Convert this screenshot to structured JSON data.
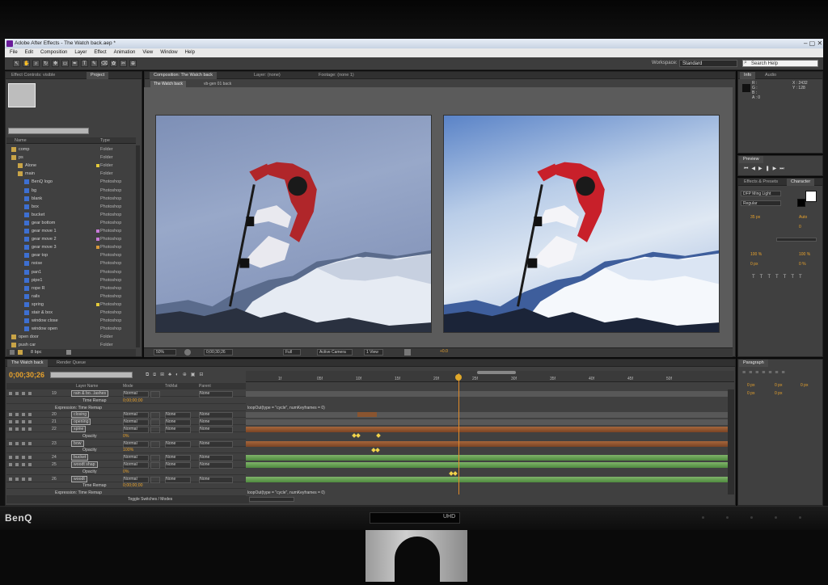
{
  "monitor": {
    "brand": "BenQ",
    "badge": "UHD"
  },
  "window": {
    "title": "Adobe After Effects - The Watch back.aep *"
  },
  "menu": [
    "File",
    "Edit",
    "Composition",
    "Layer",
    "Effect",
    "Animation",
    "View",
    "Window",
    "Help"
  ],
  "toolbar": {
    "workspace_label": "Workspace:",
    "workspace_value": "Standard",
    "search_placeholder": "Search Help"
  },
  "left_panel": {
    "tabs": [
      "Effect Controls: visible",
      "Project"
    ],
    "header": {
      "name": "Name",
      "type": "Type"
    },
    "items": [
      {
        "name": "comp",
        "type": "Folder",
        "kind": "folder",
        "indent": 0,
        "swatch": ""
      },
      {
        "name": "ps",
        "type": "Folder",
        "kind": "folder",
        "indent": 0,
        "swatch": ""
      },
      {
        "name": "Alone",
        "type": "Folder",
        "kind": "folder",
        "indent": 1,
        "swatch": "#e3c93a"
      },
      {
        "name": "main",
        "type": "Folder",
        "kind": "folder",
        "indent": 1,
        "swatch": ""
      },
      {
        "name": "BenQ logo",
        "type": "Photoshop",
        "kind": "file",
        "indent": 2,
        "swatch": ""
      },
      {
        "name": "bg",
        "type": "Photoshop",
        "kind": "file",
        "indent": 2,
        "swatch": ""
      },
      {
        "name": "blank",
        "type": "Photoshop",
        "kind": "file",
        "indent": 2,
        "swatch": ""
      },
      {
        "name": "box",
        "type": "Photoshop",
        "kind": "file",
        "indent": 2,
        "swatch": ""
      },
      {
        "name": "bucket",
        "type": "Photoshop",
        "kind": "file",
        "indent": 2,
        "swatch": ""
      },
      {
        "name": "gear bottom",
        "type": "Photoshop",
        "kind": "file",
        "indent": 2,
        "swatch": ""
      },
      {
        "name": "gear move 1",
        "type": "Photoshop",
        "kind": "file",
        "indent": 2,
        "swatch": "#c77ad8"
      },
      {
        "name": "gear move 2",
        "type": "Photoshop",
        "kind": "file",
        "indent": 2,
        "swatch": "#c77ad8"
      },
      {
        "name": "gear move 3",
        "type": "Photoshop",
        "kind": "file",
        "indent": 2,
        "swatch": "#d89a3a"
      },
      {
        "name": "gear top",
        "type": "Photoshop",
        "kind": "file",
        "indent": 2,
        "swatch": ""
      },
      {
        "name": "noise",
        "type": "Photoshop",
        "kind": "file",
        "indent": 2,
        "swatch": ""
      },
      {
        "name": "pan1",
        "type": "Photoshop",
        "kind": "file",
        "indent": 2,
        "swatch": ""
      },
      {
        "name": "pipe1",
        "type": "Photoshop",
        "kind": "file",
        "indent": 2,
        "swatch": ""
      },
      {
        "name": "rope R",
        "type": "Photoshop",
        "kind": "file",
        "indent": 2,
        "swatch": ""
      },
      {
        "name": "rails",
        "type": "Photoshop",
        "kind": "file",
        "indent": 2,
        "swatch": ""
      },
      {
        "name": "spring",
        "type": "Photoshop",
        "kind": "file",
        "indent": 2,
        "swatch": "#e3c93a"
      },
      {
        "name": "stair & box",
        "type": "Photoshop",
        "kind": "file",
        "indent": 2,
        "swatch": ""
      },
      {
        "name": "window close",
        "type": "Photoshop",
        "kind": "file",
        "indent": 2,
        "swatch": ""
      },
      {
        "name": "window open",
        "type": "Photoshop",
        "kind": "file",
        "indent": 2,
        "swatch": ""
      },
      {
        "name": "open door",
        "type": "Folder",
        "kind": "folder",
        "indent": 0,
        "swatch": ""
      },
      {
        "name": "push car",
        "type": "Folder",
        "kind": "folder",
        "indent": 0,
        "swatch": ""
      }
    ],
    "footer": "8 bpc"
  },
  "viewer": {
    "tabs": [
      "Composition: The Watch back",
      "Layer: (none)",
      "Footage: (none 1)"
    ],
    "subtabs": [
      "The Watch back",
      "vb-gen 01 back"
    ],
    "zoom": "50%",
    "timecode": "0;00;30;26",
    "resolution": "Full",
    "camera": "Active Camera",
    "views": "1 View",
    "exposure": "+0.0"
  },
  "info_panel": {
    "tabs": [
      "Info",
      "Audio"
    ],
    "r": "R :",
    "g": "G :",
    "b": "B :",
    "a": "A : 0",
    "x": "X : 2432",
    "y": "Y : 128"
  },
  "preview_panel": {
    "tab": "Preview"
  },
  "character_panel": {
    "tabs": [
      "Effects & Presets",
      "Character"
    ],
    "font": "DFP Ming Light",
    "style": "Regular",
    "size": "35 px",
    "leading": "Auto",
    "tracking": "0",
    "scale_v": "100 %",
    "scale_h": "100 %",
    "baseline": "0 px",
    "tsume": "0 %"
  },
  "timeline": {
    "tabs": [
      "The Watch back",
      "Render Queue"
    ],
    "timecode": "0;00;30;26",
    "columns": {
      "layer_name": "Layer Name",
      "mode": "Mode",
      "trkmat": "TrkMat",
      "parent": "Parent"
    },
    "ruler": [
      "1f",
      "05f",
      "10f",
      "15f",
      "20f",
      "25f",
      "30f",
      "35f",
      "40f",
      "45f",
      "50f"
    ],
    "rows": [
      {
        "idx": "19",
        "name": "rain & bo...lashes",
        "box": true,
        "mode": "Normal",
        "trk": "",
        "parent": "None",
        "kind": "layer"
      },
      {
        "idx": "",
        "name": "Time Remap",
        "box": false,
        "mode": "",
        "trk": "",
        "parent": "",
        "kind": "prop",
        "value": "0;00;00;00"
      },
      {
        "idx": "",
        "name": "Expression: Time Remap",
        "box": false,
        "kind": "expr",
        "value": "loopOut(type = \"cycle\", numKeyframes = 0)"
      },
      {
        "idx": "20",
        "name": "closing",
        "box": true,
        "mode": "Normal",
        "trk": "None",
        "parent": "None",
        "kind": "layer"
      },
      {
        "idx": "21",
        "name": "opening",
        "box": true,
        "mode": "Normal",
        "trk": "None",
        "parent": "None",
        "kind": "layer"
      },
      {
        "idx": "22",
        "name": "spine",
        "box": true,
        "mode": "Normal",
        "trk": "None",
        "parent": "None",
        "kind": "layer"
      },
      {
        "idx": "",
        "name": "Opacity",
        "box": false,
        "kind": "prop",
        "value": "0%"
      },
      {
        "idx": "23",
        "name": "bow",
        "box": true,
        "mode": "Normal",
        "trk": "None",
        "parent": "None",
        "kind": "layer"
      },
      {
        "idx": "",
        "name": "Opacity",
        "box": false,
        "kind": "prop",
        "value": "100%"
      },
      {
        "idx": "24",
        "name": "bucket",
        "box": true,
        "mode": "Normal",
        "trk": "None",
        "parent": "None",
        "kind": "layer"
      },
      {
        "idx": "25",
        "name": "woodt shap",
        "box": true,
        "mode": "Normal",
        "trk": "None",
        "parent": "None",
        "kind": "layer"
      },
      {
        "idx": "",
        "name": "Opacity",
        "box": false,
        "kind": "prop",
        "value": "0%"
      },
      {
        "idx": "26",
        "name": "woodt",
        "box": true,
        "mode": "Normal",
        "trk": "None",
        "parent": "None",
        "kind": "layer"
      },
      {
        "idx": "",
        "name": "Time Remap",
        "box": false,
        "kind": "prop",
        "value": "0;00;00;00"
      },
      {
        "idx": "",
        "name": "Expression: Time Remap",
        "box": false,
        "kind": "expr",
        "value": "loopOut(type = \"cycle\", numKeyframes = 0)"
      }
    ],
    "footer": "Toggle Switches / Modes"
  },
  "paragraph_panel": {
    "tab": "Paragraph",
    "left": "0 px",
    "right": "0 px",
    "first": "0 px",
    "before": "0 px",
    "after": "0 px"
  },
  "colors": {
    "accent_timecode": "#e8a22c",
    "bar_brown": "#a5663b",
    "bar_green": "#7fb46a"
  }
}
